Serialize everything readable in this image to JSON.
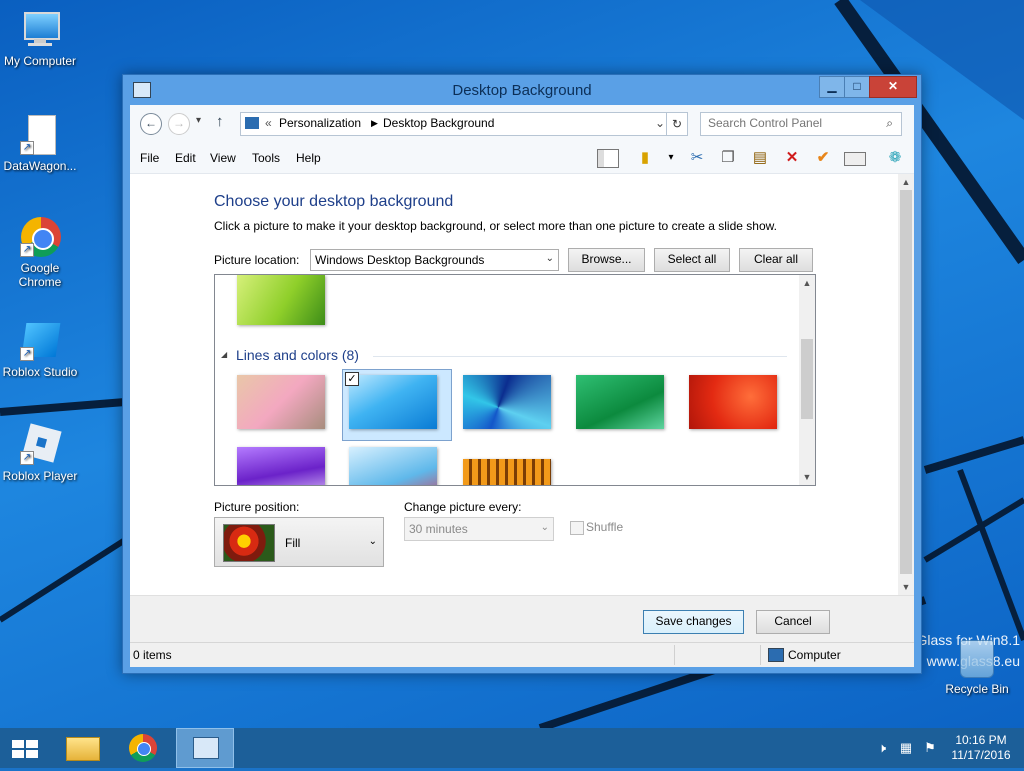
{
  "desktop": {
    "icons": [
      {
        "label": "My Computer"
      },
      {
        "label": "DataWagon..."
      },
      {
        "label": "Google Chrome"
      },
      {
        "label": "Roblox Studio"
      },
      {
        "label": "Roblox Player"
      }
    ],
    "watermark": [
      "Glass for Win8.1",
      "www.glass8.eu"
    ],
    "recycle_bin": "Recycle Bin"
  },
  "window": {
    "title": "Desktop Background",
    "address": {
      "prefix": "«",
      "crumbs": [
        "Personalization",
        "Desktop Background"
      ]
    },
    "search_placeholder": "Search Control Panel",
    "menu": [
      "File",
      "Edit",
      "View",
      "Tools",
      "Help"
    ],
    "heading": "Choose your desktop background",
    "subheading": "Click a picture to make it your desktop background, or select more than one picture to create a slide show.",
    "picture_location_label": "Picture location:",
    "picture_location_value": "Windows Desktop Backgrounds",
    "browse_label": "Browse...",
    "select_all_label": "Select all",
    "clear_all_label": "Clear all",
    "group_label": "Lines and colors (8)",
    "picture_position_label": "Picture position:",
    "picture_position_value": "Fill",
    "change_every_label": "Change picture every:",
    "change_every_value": "30 minutes",
    "shuffle_label": "Shuffle",
    "save_label": "Save changes",
    "cancel_label": "Cancel",
    "status_items": "0 items",
    "status_location": "Computer"
  },
  "taskbar": {
    "time": "10:16 PM",
    "date": "11/17/2016"
  },
  "colors": {
    "accent": "#1e3f8a",
    "taskbar": "#1c5f99",
    "close": "#c94338"
  }
}
